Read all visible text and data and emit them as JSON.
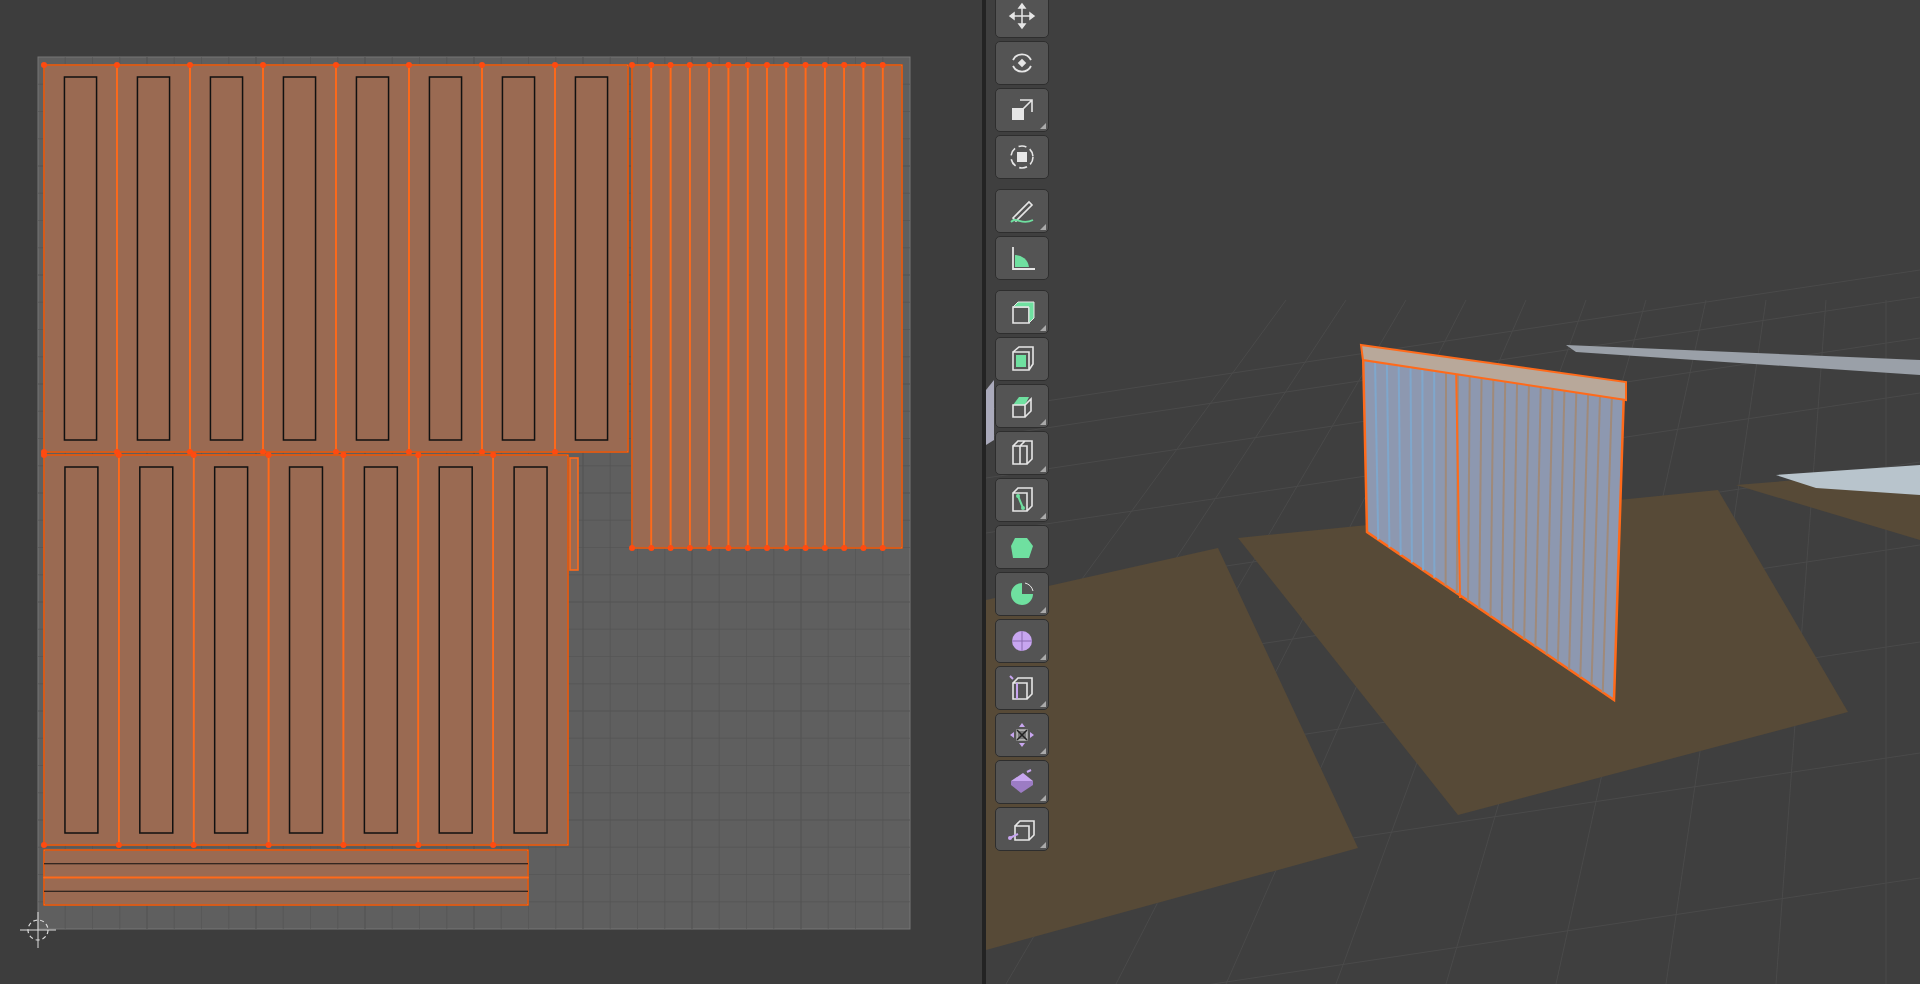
{
  "toolbar": {
    "groups": [
      {
        "tools": [
          {
            "kind": "move",
            "submenu": false
          },
          {
            "kind": "rotate",
            "submenu": false
          },
          {
            "kind": "scale",
            "submenu": true
          },
          {
            "kind": "transform",
            "submenu": false
          }
        ]
      },
      {
        "tools": [
          {
            "kind": "annotate",
            "submenu": true
          },
          {
            "kind": "measure",
            "submenu": false
          }
        ]
      },
      {
        "tools": [
          {
            "kind": "add-cube",
            "submenu": true
          },
          {
            "kind": "inset",
            "submenu": false
          },
          {
            "kind": "extrude",
            "submenu": true
          },
          {
            "kind": "loop-cut",
            "submenu": true
          },
          {
            "kind": "knife",
            "submenu": true
          },
          {
            "kind": "poly-build",
            "submenu": false
          },
          {
            "kind": "spin",
            "submenu": true
          },
          {
            "kind": "smooth",
            "submenu": true
          },
          {
            "kind": "edge-slide",
            "submenu": true
          },
          {
            "kind": "shrink",
            "submenu": true
          },
          {
            "kind": "shear",
            "submenu": true
          },
          {
            "kind": "rip",
            "submenu": true
          }
        ]
      }
    ]
  }
}
